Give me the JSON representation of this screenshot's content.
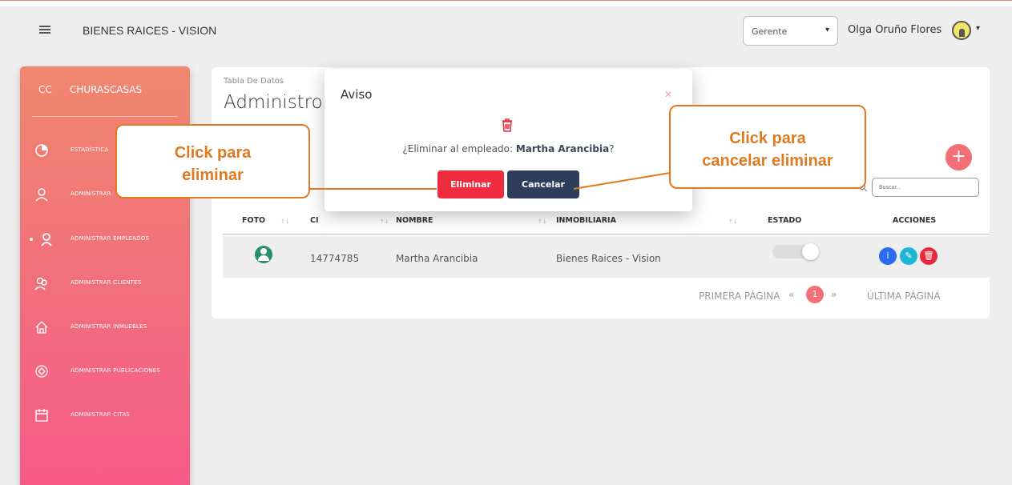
{
  "navbar": {
    "brand": "BIENES RAICES - VISION",
    "role": "Gerente",
    "user": "Olga Oruño Flores"
  },
  "sidebar": {
    "abbr": "CC",
    "name": "CHURASCASAS",
    "items": [
      {
        "label": "ESTADÍSTICA"
      },
      {
        "label": "ADMINISTRAR"
      },
      {
        "label": "ADMINISTRAR EMPLEADOS"
      },
      {
        "label": "ADMINISTRAR CLIENTES"
      },
      {
        "label": "ADMINISTRAR INMUEBLES"
      },
      {
        "label": "ADMINISTRAR PUBLICACIONES"
      },
      {
        "label": "ADMINISTRAR CITAS"
      }
    ]
  },
  "card": {
    "subtitle": "Tabla De Datos",
    "title": "Administro",
    "search_placeholder": "Buscar...",
    "columns": [
      "FOTO",
      "CI",
      "NOMBRE",
      "INMOBILIARIA",
      "ESTADO",
      "ACCIONES"
    ],
    "row": {
      "ci": "14774785",
      "nombre": "Martha Arancibia",
      "inmobiliaria": "Bienes Raices - Vision"
    },
    "pager": {
      "first": "PRIMERA PÁGINA",
      "page": "1",
      "last": "ÚLTIMA PÁGINA"
    }
  },
  "modal": {
    "title": "Aviso",
    "message_prefix": "¿Eliminar al empleado: ",
    "message_name": "Martha Arancibia",
    "message_suffix": "?",
    "delete_label": "Eliminar",
    "cancel_label": "Cancelar"
  },
  "callouts": {
    "left": [
      "Click para",
      "eliminar"
    ],
    "right": [
      "Click para",
      "cancelar eliminar"
    ]
  },
  "colors": {
    "accent": "#f46e78",
    "delete": "#ef2d3f",
    "cancel": "#2c3e5c",
    "callout": "#e0791f"
  }
}
